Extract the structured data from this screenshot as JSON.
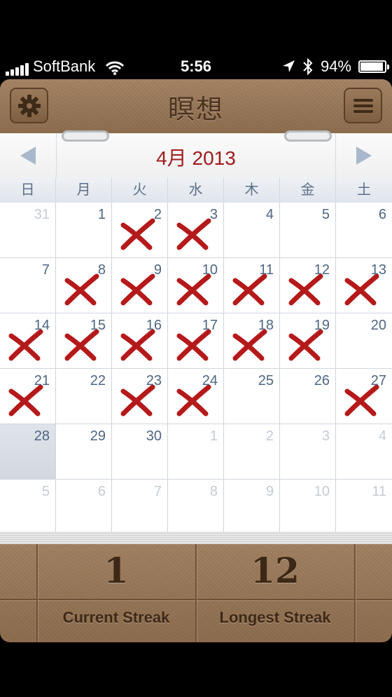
{
  "status": {
    "carrier": "SoftBank",
    "time": "5:56",
    "battery": "94%",
    "battery_level": 0.94
  },
  "header": {
    "title": "瞑想",
    "settings_icon": "gear-icon",
    "menu_icon": "list-icon"
  },
  "calendar": {
    "month_label": "4月 2013",
    "weekdays": [
      "日",
      "月",
      "火",
      "水",
      "木",
      "金",
      "土"
    ],
    "days": [
      {
        "n": "31",
        "dim": true,
        "x": false
      },
      {
        "n": "1",
        "dim": false,
        "x": false
      },
      {
        "n": "2",
        "dim": false,
        "x": true
      },
      {
        "n": "3",
        "dim": false,
        "x": true
      },
      {
        "n": "4",
        "dim": false,
        "x": false
      },
      {
        "n": "5",
        "dim": false,
        "x": false
      },
      {
        "n": "6",
        "dim": false,
        "x": false
      },
      {
        "n": "7",
        "dim": false,
        "x": false
      },
      {
        "n": "8",
        "dim": false,
        "x": true
      },
      {
        "n": "9",
        "dim": false,
        "x": true
      },
      {
        "n": "10",
        "dim": false,
        "x": true
      },
      {
        "n": "11",
        "dim": false,
        "x": true
      },
      {
        "n": "12",
        "dim": false,
        "x": true
      },
      {
        "n": "13",
        "dim": false,
        "x": true
      },
      {
        "n": "14",
        "dim": false,
        "x": true
      },
      {
        "n": "15",
        "dim": false,
        "x": true
      },
      {
        "n": "16",
        "dim": false,
        "x": true
      },
      {
        "n": "17",
        "dim": false,
        "x": true
      },
      {
        "n": "18",
        "dim": false,
        "x": true
      },
      {
        "n": "19",
        "dim": false,
        "x": true
      },
      {
        "n": "20",
        "dim": false,
        "x": false
      },
      {
        "n": "21",
        "dim": false,
        "x": true
      },
      {
        "n": "22",
        "dim": false,
        "x": false
      },
      {
        "n": "23",
        "dim": false,
        "x": true
      },
      {
        "n": "24",
        "dim": false,
        "x": true
      },
      {
        "n": "25",
        "dim": false,
        "x": false
      },
      {
        "n": "26",
        "dim": false,
        "x": false
      },
      {
        "n": "27",
        "dim": false,
        "x": true
      },
      {
        "n": "28",
        "dim": false,
        "x": false,
        "today": true
      },
      {
        "n": "29",
        "dim": false,
        "x": false
      },
      {
        "n": "30",
        "dim": false,
        "x": false
      },
      {
        "n": "1",
        "dim": true,
        "x": false
      },
      {
        "n": "2",
        "dim": true,
        "x": false
      },
      {
        "n": "3",
        "dim": true,
        "x": false
      },
      {
        "n": "4",
        "dim": true,
        "x": false
      },
      {
        "n": "5",
        "dim": true,
        "x": false
      },
      {
        "n": "6",
        "dim": true,
        "x": false
      },
      {
        "n": "7",
        "dim": true,
        "x": false
      },
      {
        "n": "8",
        "dim": true,
        "x": false
      },
      {
        "n": "9",
        "dim": true,
        "x": false
      },
      {
        "n": "10",
        "dim": true,
        "x": false
      },
      {
        "n": "11",
        "dim": true,
        "x": false
      }
    ],
    "mark_color": "#b51a1a"
  },
  "stats": {
    "current_value": "1",
    "current_label": "Current Streak",
    "longest_value": "12",
    "longest_label": "Longest Streak"
  }
}
